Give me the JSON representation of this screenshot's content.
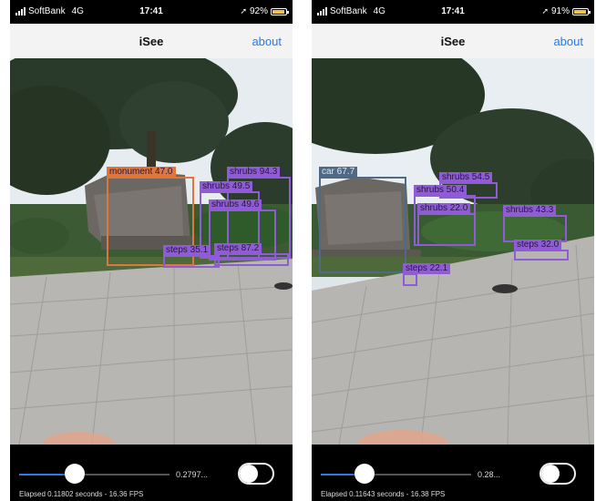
{
  "screens": [
    {
      "status": {
        "carrier": "SoftBank",
        "network": "4G",
        "time": "17:41",
        "battery": "92%",
        "battery_level": 0.92
      },
      "nav": {
        "title": "iSee",
        "about": "about"
      },
      "detections": [
        {
          "label": "monument 47.0",
          "color": "#e0763a"
        },
        {
          "label": "shrubs 94.3",
          "color": "#8f5bd6"
        },
        {
          "label": "shrubs 49.5",
          "color": "#8f5bd6"
        },
        {
          "label": "shrubs 49.6",
          "color": "#8f5bd6"
        },
        {
          "label": "steps 35.1",
          "color": "#8f5bd6"
        },
        {
          "label": "steps 87.2",
          "color": "#8f5bd6"
        }
      ],
      "controls": {
        "threshold": "0.2797...",
        "slider_level": 0.37,
        "toggle_on": false
      },
      "elapsed": "Elapsed 0.11802 seconds - 16.36 FPS"
    },
    {
      "status": {
        "carrier": "SoftBank",
        "network": "4G",
        "time": "17:41",
        "battery": "91%",
        "battery_level": 0.91
      },
      "nav": {
        "title": "iSee",
        "about": "about"
      },
      "detections": [
        {
          "label": "car 67.7",
          "color": "#4f6a86"
        },
        {
          "label": "shrubs 54.5",
          "color": "#8f5bd6"
        },
        {
          "label": "shrubs 50.4",
          "color": "#8f5bd6"
        },
        {
          "label": "shrubs 22.0",
          "color": "#8f5bd6"
        },
        {
          "label": "shrubs 43.3",
          "color": "#8f5bd6"
        },
        {
          "label": "steps 32.0",
          "color": "#8f5bd6"
        },
        {
          "label": "steps 22.1",
          "color": "#8f5bd6"
        }
      ],
      "controls": {
        "threshold": "0.28...",
        "slider_level": 0.29,
        "toggle_on": false
      },
      "elapsed": "Elapsed 0.11643 seconds - 16.38 FPS"
    }
  ],
  "colors": {
    "accent": "#1f7cf0",
    "slider": "#2f7ae5",
    "navbar": "#f3f3f3"
  },
  "icons": [
    "signal-bars-icon",
    "location-arrow-icon",
    "battery-icon",
    "toggle-switch-icon",
    "slider-thumb-icon"
  ]
}
